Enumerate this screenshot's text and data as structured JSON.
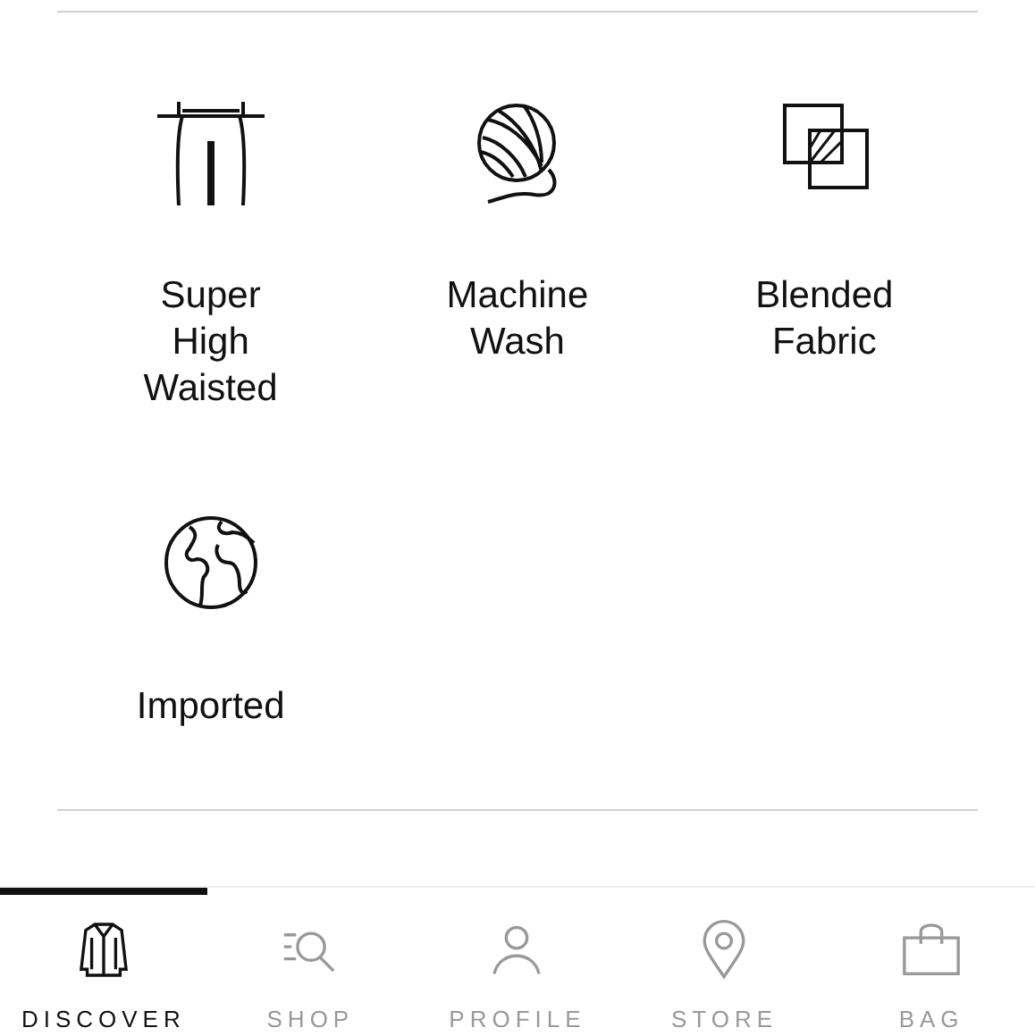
{
  "features": [
    {
      "kind": "waist",
      "label": "Super High Waisted"
    },
    {
      "kind": "wash",
      "label": "Machine Wash"
    },
    {
      "kind": "blend",
      "label": "Blended Fabric"
    },
    {
      "kind": "globe",
      "label": "Imported"
    }
  ],
  "nav": [
    {
      "kind": "discover",
      "label": "DISCOVER",
      "selected": true
    },
    {
      "kind": "shop",
      "label": "SHOP",
      "selected": false
    },
    {
      "kind": "profile",
      "label": "PROFILE",
      "selected": false
    },
    {
      "kind": "store",
      "label": "STORE",
      "selected": false
    },
    {
      "kind": "bag",
      "label": "BAG",
      "selected": false
    }
  ]
}
